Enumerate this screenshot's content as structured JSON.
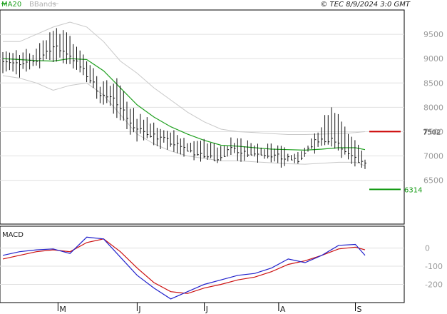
{
  "header": {
    "legend_ma": "MA20",
    "legend_bbands": "BBands",
    "timestamp": "© TEC 8/9/2024 3:0 GMT"
  },
  "colors": {
    "price": "#111111",
    "ma": "#1fa01f",
    "bbands": "#c8c8c8",
    "resistance": "#cc0000",
    "support": "#119911",
    "macd": "#2222cc",
    "signal": "#cc1111",
    "grid": "#e0e0e0"
  },
  "chart_data": [
    {
      "type": "line",
      "subtype": "price-bars-with-moving-average-and-bollinger-bands",
      "ylim": [
        5600,
        10000
      ],
      "yticks": [
        6500,
        7000,
        7500,
        8000,
        8500,
        9000,
        9500
      ],
      "grid": true,
      "x": [
        "2024-04-08",
        "2024-04-15",
        "2024-04-22",
        "2024-04-29",
        "2024-05-06",
        "2024-05-13",
        "2024-05-20",
        "2024-05-27",
        "2024-06-03",
        "2024-06-10",
        "2024-06-17",
        "2024-06-24",
        "2024-07-01",
        "2024-07-08",
        "2024-07-15",
        "2024-07-22",
        "2024-07-29",
        "2024-08-05",
        "2024-08-12",
        "2024-08-19",
        "2024-08-26",
        "2024-09-02",
        "2024-09-06"
      ],
      "xticks": [
        {
          "date": "2024-05-01",
          "label": "M"
        },
        {
          "date": "2024-06-03",
          "label": "J"
        },
        {
          "date": "2024-07-01",
          "label": "J"
        },
        {
          "date": "2024-08-01",
          "label": "A"
        },
        {
          "date": "2024-09-02",
          "label": "S"
        }
      ],
      "series": [
        {
          "role": "close",
          "values": [
            9000,
            8850,
            8950,
            9250,
            9100,
            8700,
            8250,
            8100,
            7550,
            7450,
            7300,
            7150,
            7000,
            6950,
            7150,
            7050,
            7050,
            6950,
            6900,
            7300,
            7350,
            7000,
            6800
          ]
        },
        {
          "role": "high",
          "values": [
            9300,
            9200,
            9250,
            9650,
            9600,
            9100,
            8550,
            8650,
            7950,
            7800,
            7650,
            7450,
            7400,
            7300,
            7400,
            7350,
            7300,
            7200,
            7150,
            7550,
            8150,
            7500,
            7050
          ]
        },
        {
          "role": "low",
          "values": [
            8650,
            8600,
            8700,
            8900,
            8800,
            8500,
            8000,
            7750,
            7300,
            7250,
            7050,
            6950,
            6850,
            6800,
            6900,
            6850,
            6850,
            6750,
            6750,
            7050,
            7100,
            6800,
            6700
          ]
        },
        {
          "name": "MA20",
          "values": [
            9000,
            8980,
            8960,
            8950,
            9000,
            8980,
            8750,
            8400,
            8050,
            7800,
            7600,
            7450,
            7320,
            7220,
            7200,
            7170,
            7140,
            7130,
            7120,
            7140,
            7170,
            7170,
            7130
          ]
        },
        {
          "role": "bband-upper",
          "values": [
            9350,
            9350,
            9500,
            9650,
            9750,
            9650,
            9350,
            8950,
            8700,
            8400,
            8150,
            7900,
            7700,
            7550,
            7500,
            7480,
            7460,
            7440,
            7440,
            7450,
            7460,
            7480,
            7500
          ]
        },
        {
          "role": "bband-lower",
          "values": [
            8650,
            8600,
            8500,
            8350,
            8450,
            8500,
            8250,
            7850,
            7450,
            7250,
            7100,
            7000,
            6950,
            6900,
            6900,
            6880,
            6860,
            6840,
            6830,
            6850,
            6870,
            6870,
            6800
          ]
        }
      ],
      "levels": [
        {
          "kind": "resistance",
          "value": 7502,
          "label": "7502"
        },
        {
          "kind": "support",
          "value": 6314,
          "label": "6314"
        }
      ]
    },
    {
      "type": "line",
      "title": "MACD",
      "ylim": [
        -300,
        120
      ],
      "yticks": [
        0,
        -100,
        -200
      ],
      "grid": true,
      "x": [
        "2024-04-08",
        "2024-04-15",
        "2024-04-22",
        "2024-04-29",
        "2024-05-06",
        "2024-05-13",
        "2024-05-20",
        "2024-05-27",
        "2024-06-03",
        "2024-06-10",
        "2024-06-17",
        "2024-06-24",
        "2024-07-01",
        "2024-07-08",
        "2024-07-15",
        "2024-07-22",
        "2024-07-29",
        "2024-08-05",
        "2024-08-12",
        "2024-08-19",
        "2024-08-26",
        "2024-09-02",
        "2024-09-06"
      ],
      "series": [
        {
          "role": "macd",
          "values": [
            -40,
            -20,
            -10,
            -5,
            -30,
            60,
            50,
            -50,
            -150,
            -220,
            -280,
            -240,
            -200,
            -175,
            -150,
            -140,
            -110,
            -60,
            -80,
            -40,
            15,
            20,
            -40
          ]
        },
        {
          "role": "signal",
          "values": [
            -60,
            -40,
            -20,
            -10,
            -20,
            30,
            50,
            -20,
            -110,
            -190,
            -240,
            -250,
            -220,
            -200,
            -175,
            -160,
            -130,
            -90,
            -70,
            -40,
            -5,
            5,
            -10
          ]
        }
      ]
    }
  ]
}
